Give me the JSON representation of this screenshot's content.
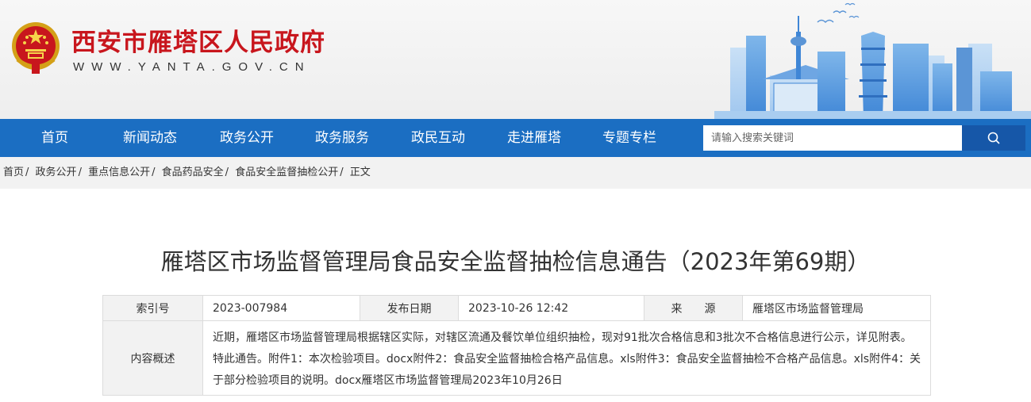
{
  "site": {
    "title": "西安市雁塔区人民政府",
    "domain": "WWW.YANTA.GOV.CN"
  },
  "nav": {
    "items": [
      "首页",
      "新闻动态",
      "政务公开",
      "政务服务",
      "政民互动",
      "走进雁塔",
      "专题专栏"
    ],
    "search_placeholder": "请输入搜索关键词",
    "search_icon": "search-icon"
  },
  "breadcrumb": [
    "首页",
    "政务公开",
    "重点信息公开",
    "食品药品安全",
    "食品安全监督抽检公开",
    "正文"
  ],
  "article": {
    "title": "雁塔区市场监督管理局食品安全监督抽检信息通告（2023年第69期）"
  },
  "meta": {
    "index_label": "索引号",
    "index_value": "2023-007984",
    "date_label": "发布日期",
    "date_value": "2023-10-26 12:42",
    "source_label": "来　　源",
    "source_value": "雁塔区市场监督管理局",
    "summary_label": "内容概述",
    "summary_value": "近期，雁塔区市场监督管理局根据辖区实际，对辖区流通及餐饮单位组织抽检，现对91批次合格信息和3批次不合格信息进行公示，详见附表。特此通告。附件1：本次检验项目。docx附件2：食品安全监督抽检合格产品信息。xls附件3：食品安全监督抽检不合格产品信息。xls附件4：关于部分检验项目的说明。docx雁塔区市场监督管理局2023年10月26日"
  },
  "colors": {
    "brand_red": "#c8161d",
    "nav_blue": "#1b6ec2",
    "search_btn": "#1657a8"
  }
}
